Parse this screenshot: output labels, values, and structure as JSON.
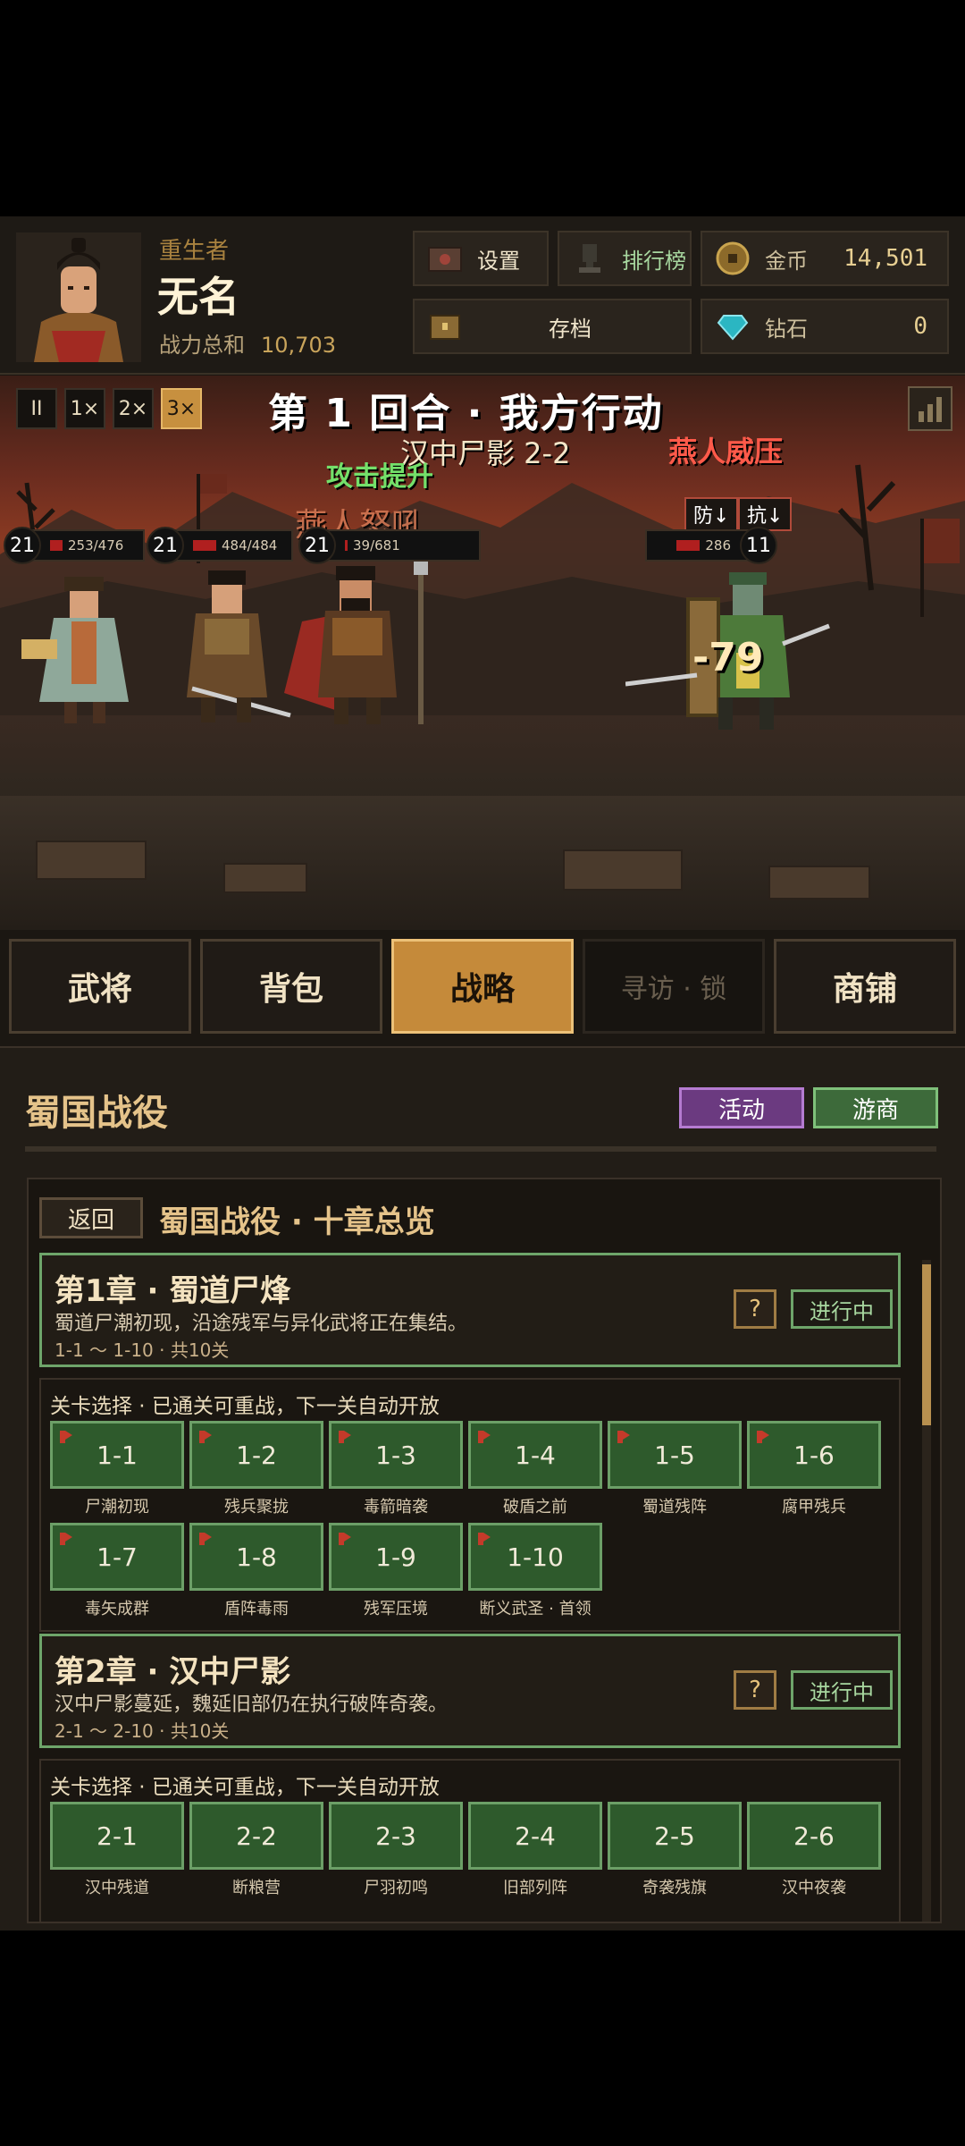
{
  "header": {
    "rank": "重生者",
    "name": "无名",
    "power_label": "战力总和",
    "power_value": "10,703",
    "settings": "设置",
    "leaderboard": "排行榜",
    "save": "存档",
    "gold_label": "金币",
    "gold_value": "14,501",
    "diamond_label": "钻石",
    "diamond_value": "0"
  },
  "battle": {
    "speeds": [
      "II",
      "1×",
      "2×",
      "3×"
    ],
    "active_speed": "3×",
    "round_text": "第 1 回合 · 我方行动",
    "stage": "汉中尸影 2-2",
    "float_buff": "攻击提升",
    "float_enemy": "燕人威压",
    "float_hero": "燕人怒吼",
    "damage": "-79",
    "allies": [
      {
        "level": "21",
        "hp": "253/476",
        "hp_ratio": 0.53
      },
      {
        "level": "21",
        "hp": "484/484",
        "hp_ratio": 1.0
      },
      {
        "level": "21",
        "hp": "39/681",
        "hp_ratio": 0.06
      }
    ],
    "enemy": {
      "level": "11",
      "hp": "286"
    },
    "enemy_debuffs": [
      "防↓",
      "抗↓"
    ]
  },
  "tabs": [
    {
      "label": "武将",
      "state": "normal"
    },
    {
      "label": "背包",
      "state": "normal"
    },
    {
      "label": "战略",
      "state": "active"
    },
    {
      "label": "寻访 · 锁",
      "state": "locked"
    },
    {
      "label": "商铺",
      "state": "normal"
    }
  ],
  "main": {
    "title": "蜀国战役",
    "activity": "活动",
    "merchant": "游商",
    "back": "返回",
    "panel_title": "蜀国战役 · 十章总览",
    "level_hint": "关卡选择 · 已通关可重战，下一关自动开放",
    "chapters": [
      {
        "title": "第1章 · 蜀道尸烽",
        "desc": "蜀道尸潮初现，沿途残军与异化武将正在集结。",
        "range": "1-1 ～ 1-10 · 共10关",
        "help": "?",
        "status": "进行中",
        "levels": [
          {
            "id": "1-1",
            "name": "尸潮初现"
          },
          {
            "id": "1-2",
            "name": "残兵聚拢"
          },
          {
            "id": "1-3",
            "name": "毒箭暗袭"
          },
          {
            "id": "1-4",
            "name": "破盾之前"
          },
          {
            "id": "1-5",
            "name": "蜀道残阵"
          },
          {
            "id": "1-6",
            "name": "腐甲残兵"
          },
          {
            "id": "1-7",
            "name": "毒矢成群"
          },
          {
            "id": "1-8",
            "name": "盾阵毒雨"
          },
          {
            "id": "1-9",
            "name": "残军压境"
          },
          {
            "id": "1-10",
            "name": "断义武圣 · 首领"
          }
        ]
      },
      {
        "title": "第2章 · 汉中尸影",
        "desc": "汉中尸影蔓延，魏延旧部仍在执行破阵奇袭。",
        "range": "2-1 ～ 2-10 · 共10关",
        "help": "?",
        "status": "进行中",
        "levels": [
          {
            "id": "2-1",
            "name": "汉中残道"
          },
          {
            "id": "2-2",
            "name": "断粮营"
          },
          {
            "id": "2-3",
            "name": "尸羽初鸣"
          },
          {
            "id": "2-4",
            "name": "旧部列阵"
          },
          {
            "id": "2-5",
            "name": "奇袭残旗"
          },
          {
            "id": "2-6",
            "name": "汉中夜袭"
          }
        ]
      }
    ]
  },
  "colors": {
    "accent": "#c58a3a",
    "level_green": "#2e5a2c",
    "status_green": "#6ea56a"
  }
}
